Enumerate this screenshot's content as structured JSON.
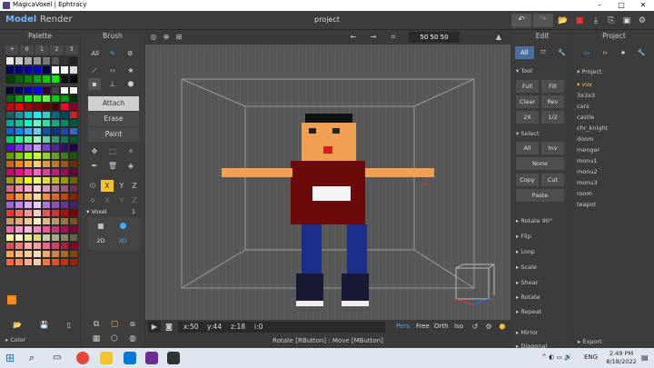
{
  "window": {
    "title": "MagicaVoxel | Ephtracy",
    "minimize": "–",
    "maximize": "□",
    "close": "✕"
  },
  "menubar": {
    "model": "Model",
    "render": "Render",
    "project_name": "project",
    "toolbar_icons": [
      "undo-icon",
      "redo-icon",
      "open-icon",
      "save-icon",
      "import-icon",
      "export-icon",
      "snapshot-icon",
      "settings-icon"
    ]
  },
  "palette": {
    "title": "Palette",
    "page_buttons": [
      "+",
      "0",
      "1",
      "2",
      "3"
    ],
    "footer_label": "Color",
    "colors": [
      "#ffffff",
      "#c8c8c8",
      "#aaaaaa",
      "#888888",
      "#666666",
      "#ffffff",
      "#ffffff",
      "#ffffff",
      "#000033",
      "#000066",
      "#0000aa",
      "#0000ff",
      "#330033",
      "#444444",
      "#ffffff",
      "#ffffff",
      "#006600",
      "#00aa00",
      "#00ff00",
      "#33ff00",
      "#66ff33",
      "#00cc00",
      "#009900",
      "#003300",
      "#cc0000",
      "#ff0000",
      "#aa0000",
      "#880000",
      "#660000",
      "#440000",
      "#ff0033",
      "#880022",
      "#006666",
      "#009999",
      "#00cccc",
      "#00ffff",
      "#33cccc",
      "#006688",
      "#004466",
      "#cc2222",
      "#00aaaa",
      "#00cc99",
      "#00ffcc",
      "#66ffcc",
      "#33ddaa",
      "#11aa88",
      "#008866",
      "#005544",
      "#0066cc",
      "#0088ff",
      "#33aaff",
      "#66ccff",
      "#0055aa",
      "#003388",
      "#2244aa",
      "#3366cc",
      "#00cc66",
      "#33ff99",
      "#66ff99",
      "#99ffcc",
      "#66ccaa",
      "#339977",
      "#117755",
      "#005533",
      "#6600cc",
      "#8833ff",
      "#aa66ff",
      "#cc99ff",
      "#7744cc",
      "#552299",
      "#331166",
      "#220044",
      "#669900",
      "#88cc00",
      "#aaff00",
      "#ccff33",
      "#99cc33",
      "#669933",
      "#447722",
      "#225511",
      "#cc6600",
      "#ff8800",
      "#ffaa33",
      "#ffcc66",
      "#dd9944",
      "#bb7722",
      "#995511",
      "#663300",
      "#cc0066",
      "#ff0088",
      "#ff33aa",
      "#ff66cc",
      "#dd4499",
      "#bb2277",
      "#991155",
      "#660033",
      "#999900",
      "#cccc00",
      "#ffff00",
      "#ffff66",
      "#dddd44",
      "#bbbb22",
      "#999911",
      "#666600",
      "#cc6699",
      "#ff88bb",
      "#ffaacc",
      "#ffccdd",
      "#dd99bb",
      "#bb7799",
      "#995577",
      "#663355",
      "#ff6600",
      "#ff9933",
      "#ffbb66",
      "#ffdd99",
      "#ff8844",
      "#dd6622",
      "#bb4411",
      "#882200",
      "#9966cc",
      "#bb88ee",
      "#ddaaff",
      "#eeccff",
      "#aa77dd",
      "#8855bb",
      "#663399",
      "#442266",
      "#ff3333",
      "#ff6666",
      "#ff9999",
      "#ffcccc",
      "#ee5555",
      "#cc3333",
      "#aa1111",
      "#770000",
      "#cc9966",
      "#ddaa77",
      "#eecc99",
      "#ffeecc",
      "#ddbb88",
      "#bb9966",
      "#997744",
      "#775522",
      "#ff66aa",
      "#ff99cc",
      "#ffbbdd",
      "#ff88bb",
      "#ee5599",
      "#cc3377",
      "#aa1155",
      "#880033",
      "#ffff99",
      "#ffffcc",
      "#eeee88",
      "#dddd66",
      "#ccccaa",
      "#aaaa88",
      "#888866",
      "#666644",
      "#ff4444",
      "#ff7777",
      "#ffaaaa",
      "#ff99aa",
      "#ee6688",
      "#cc4466",
      "#aa2244",
      "#880022",
      "#ffaa44",
      "#ffbb77",
      "#ffcc99",
      "#ffddbb",
      "#eeaa66",
      "#cc8844",
      "#aa6622",
      "#884400",
      "#ff6633",
      "#ff8855",
      "#ffaa88",
      "#ffccaa",
      "#ff7744",
      "#dd5522",
      "#bb3311",
      "#992200"
    ]
  },
  "brush": {
    "title": "Brush",
    "tab_all": "All",
    "modes": [
      "Attach",
      "Erase",
      "Paint"
    ],
    "axes": [
      "X",
      "Y",
      "Z"
    ],
    "voxel_label": "Voxel",
    "voxel_count": "1",
    "dim2": "2D",
    "dim3": "3D"
  },
  "viewport": {
    "dims": "50  50  50",
    "status": {
      "x": "x:50",
      "y": "y:44",
      "z": "z:18",
      "i": "i:0"
    },
    "view_modes": [
      "Pers",
      "Free",
      "Orth",
      "Iso"
    ],
    "hint": "Rotate [RButton] : Move [MButton]"
  },
  "edit": {
    "title": "Edit",
    "tab_all": "All",
    "tool_label": "Tool",
    "tool_buttons": [
      "Full",
      "Fill",
      "Clear",
      "Rev",
      "2X",
      "1/2"
    ],
    "select_label": "Select",
    "select_buttons": [
      "All",
      "Inv",
      "None",
      "Copy",
      "Cut",
      "Paste"
    ],
    "sections": [
      "Rotate 90°",
      "Flip",
      "Loop",
      "Scale",
      "Shear",
      "Rotate",
      "Repeat",
      "Mirror",
      "Diagonal"
    ]
  },
  "project": {
    "title": "Project",
    "root": "Project",
    "folder": "vox",
    "items": [
      "3x3x3",
      "cars",
      "castle",
      "chr_knight",
      "doom",
      "menger",
      "monu1",
      "monu2",
      "monu3",
      "room",
      "teapot"
    ],
    "footer_label": "Export"
  },
  "taskbar": {
    "time": "2:49 PM",
    "date": "8/18/2022",
    "lang": "ENG"
  }
}
